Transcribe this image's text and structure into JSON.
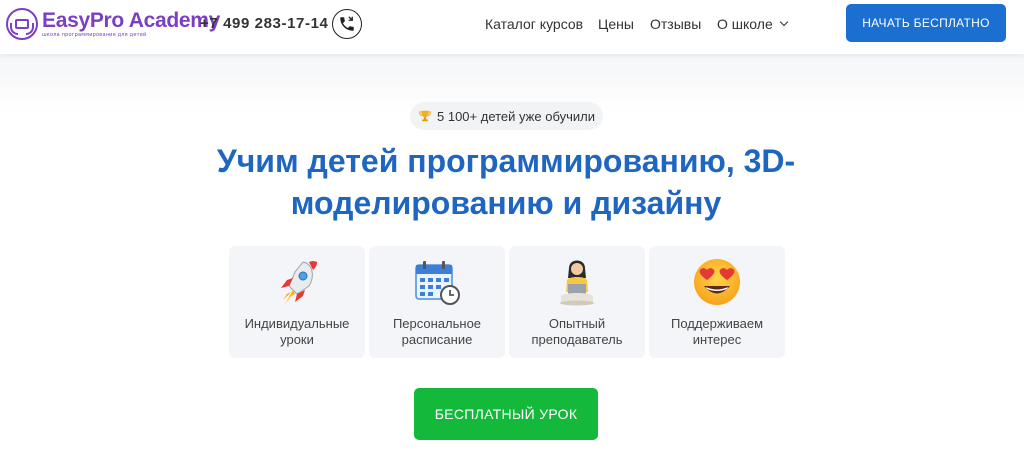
{
  "header": {
    "logo": {
      "name": "EasyPro Academy",
      "tagline": "школа программирования для детей"
    },
    "phone": "+7 499 283-17-14",
    "nav": [
      {
        "label": "Каталог курсов"
      },
      {
        "label": "Цены"
      },
      {
        "label": "Отзывы"
      },
      {
        "label": "О школе"
      }
    ],
    "cta": "НАЧАТЬ БЕСПЛАТНО"
  },
  "hero": {
    "badge": "5 100+ детей уже обучили",
    "title_line1": "Учим детей программированию, 3D-",
    "title_line2": "моделированию и дизайну",
    "features": [
      {
        "line1": "Индивидуальные",
        "line2": "уроки",
        "icon": "rocket-icon"
      },
      {
        "line1": "Персональное",
        "line2": "расписание",
        "icon": "calendar-clock-icon"
      },
      {
        "line1": "Опытный",
        "line2": "преподаватель",
        "icon": "teacher-icon"
      },
      {
        "line1": "Поддерживаем",
        "line2": "интерес",
        "icon": "heart-eyes-emoji-icon"
      }
    ],
    "cta": "БЕСПЛАТНЫЙ УРОК"
  },
  "colors": {
    "brand": "#7b3fc4",
    "accent_blue": "#1b6fd1",
    "headline_blue": "#1e66c0",
    "cta_green": "#14b83a"
  }
}
